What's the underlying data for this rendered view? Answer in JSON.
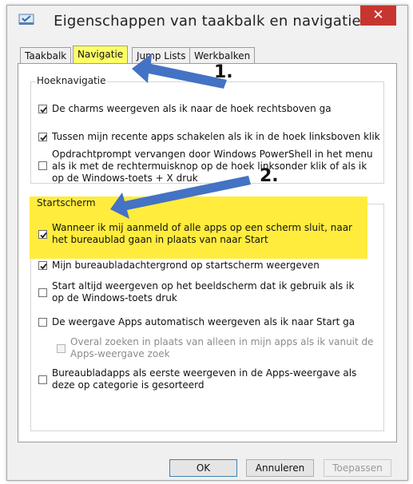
{
  "window": {
    "title": "Eigenschappen van taakbalk en navigatie",
    "close_glyph": "✕"
  },
  "tabs": [
    {
      "label": "Taakbalk",
      "active": false
    },
    {
      "label": "Navigatie",
      "active": true
    },
    {
      "label": "Jump Lists",
      "active": false
    },
    {
      "label": "Werkbalken",
      "active": false
    }
  ],
  "hoeknavigatie": {
    "title": "Hoeknavigatie",
    "options": [
      {
        "label": "De charms weergeven als ik naar de hoek rechtsboven ga",
        "checked": true
      },
      {
        "label": "Tussen mijn recente apps schakelen als ik in de hoek linksboven klik",
        "checked": true
      },
      {
        "label": "Opdrachtprompt vervangen door Windows PowerShell in het menu als ik met de rechtermuisknop op de hoek linksonder klik of als ik op de Windows-toets + X druk",
        "checked": false
      }
    ]
  },
  "startscherm": {
    "title": "Startscherm",
    "options": [
      {
        "label": "Wanneer ik mij aanmeld of alle apps op een scherm sluit, naar het bureaublad gaan in plaats van naar Start",
        "checked": true
      },
      {
        "label": "Mijn bureaubladachtergrond op startscherm weergeven",
        "checked": true
      },
      {
        "label": "Start altijd weergeven op het beeldscherm dat ik gebruik als ik op de Windows-toets druk",
        "checked": false
      },
      {
        "label": "De weergave Apps automatisch weergeven als ik naar Start ga",
        "checked": false
      },
      {
        "label": "Overal zoeken in plaats van alleen in mijn apps als ik vanuit de Apps-weergave zoek",
        "checked": false,
        "disabled": true
      },
      {
        "label": "Bureaubladapps als eerste weergeven in de Apps-weergave als deze op categorie is gesorteerd",
        "checked": false
      }
    ]
  },
  "buttons": {
    "ok": "OK",
    "cancel": "Annuleren",
    "apply": "Toepassen"
  },
  "annotations": {
    "one": "1.",
    "two": "2.",
    "arrow_color": "#4472c4",
    "highlight_color": "#ffec3d"
  }
}
